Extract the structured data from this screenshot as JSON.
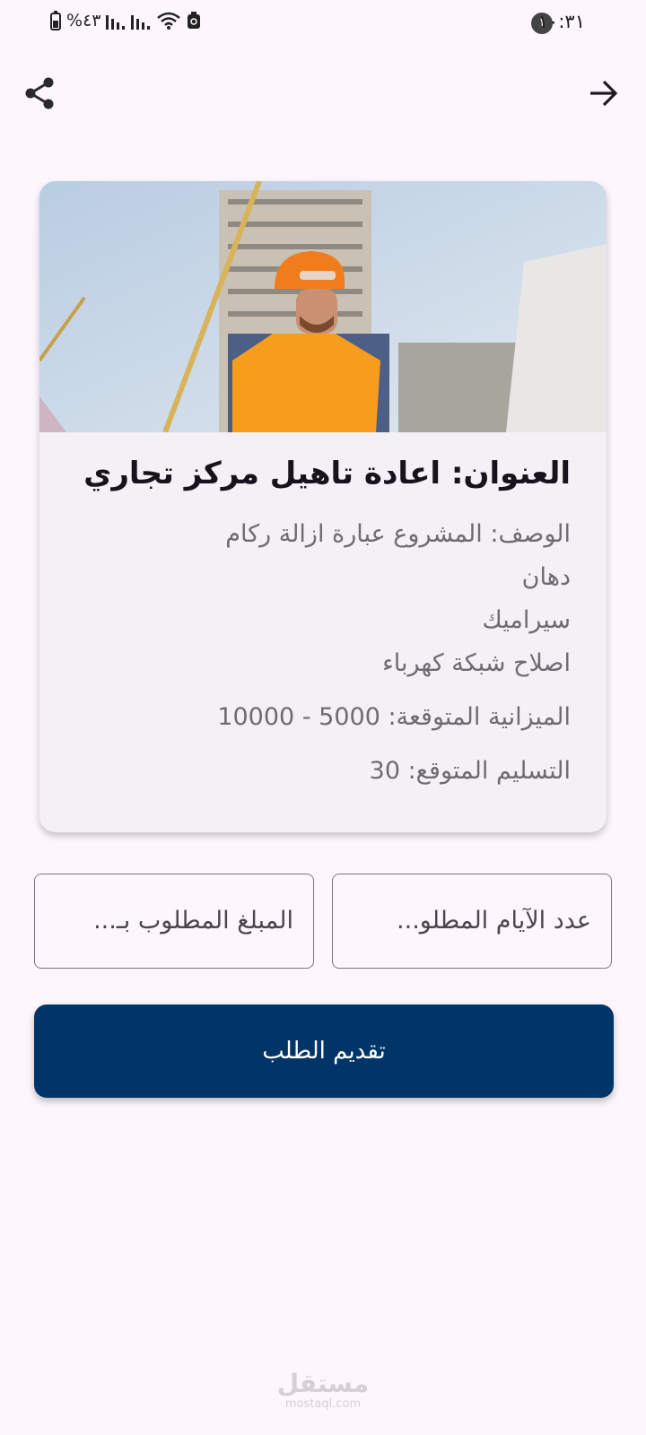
{
  "status_bar": {
    "time": "١٠:٣١",
    "notification_count": "١",
    "battery": "%٤٣"
  },
  "top_bar": {
    "share_icon": "share-icon",
    "back_icon": "arrow-forward-icon"
  },
  "project": {
    "image_icon": "construction-worker-photo",
    "title": "العنوان: اعادة تاهيل مركز تجاري",
    "description": "الوصف: المشروع عبارة ازالة ركام\nدهان\n سيراميك\nاصلاح شبكة كهرباء",
    "budget": "الميزانية المتوقعة: 5000 - 10000",
    "delivery": "التسليم المتوقع: 30"
  },
  "form": {
    "days_placeholder": "عدد الآيام المطلو...",
    "amount_placeholder": "المبلغ المطلوب بـ...",
    "submit_label": "تقديم الطلب"
  },
  "watermark": {
    "main": "مستقل",
    "sub": "mostaql.com"
  },
  "colors": {
    "background": "#fdf7fd",
    "card": "#f4f1f6",
    "primary_button": "#013567"
  }
}
